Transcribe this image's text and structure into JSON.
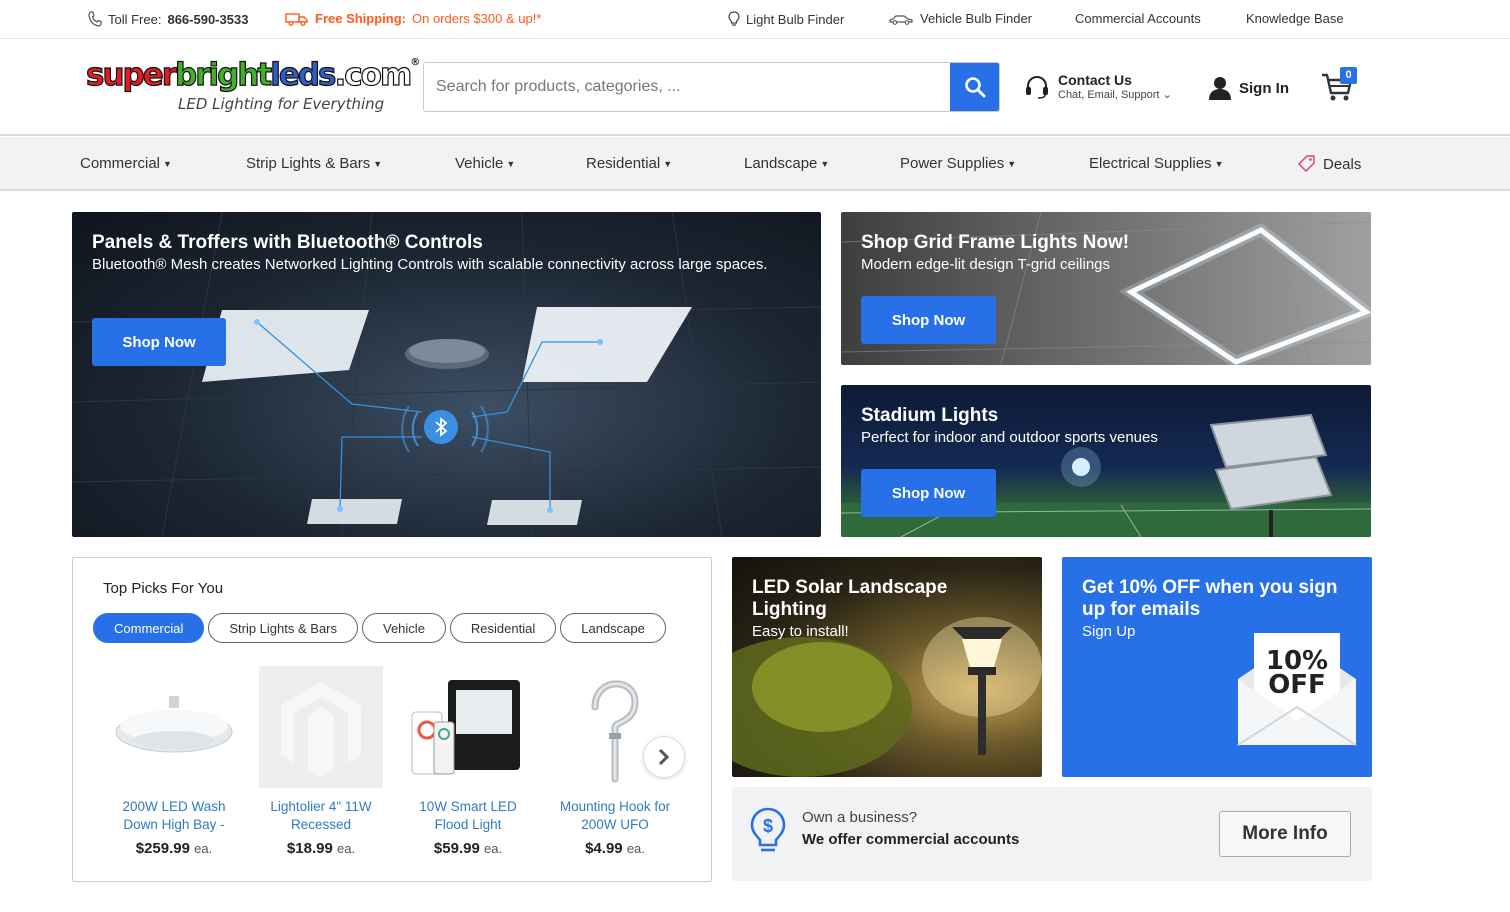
{
  "topbar": {
    "toll_free_label": "Toll Free:",
    "toll_free_number": "866-590-3533",
    "shipping_bold": "Free Shipping:",
    "shipping_text": "On orders $300 & up!*",
    "links": [
      "Light Bulb Finder",
      "Vehicle Bulb Finder",
      "Commercial Accounts",
      "Knowledge Base"
    ]
  },
  "header": {
    "logo_parts": [
      "super",
      "bright",
      "leds",
      ".com"
    ],
    "logo_reg": "®",
    "tagline": "LED Lighting for Everything",
    "search_placeholder": "Search for products, categories, ...",
    "contact_title": "Contact Us",
    "contact_sub": "Chat, Email, Support",
    "signin": "Sign In",
    "cart_count": "0"
  },
  "nav": {
    "items": [
      "Commercial",
      "Strip Lights & Bars",
      "Vehicle",
      "Residential",
      "Landscape",
      "Power Supplies",
      "Electrical Supplies"
    ],
    "deals": "Deals"
  },
  "banners": {
    "panels": {
      "title": "Panels & Troffers with Bluetooth® Controls",
      "text": "Bluetooth® Mesh creates Networked Lighting Controls with scalable connectivity across large spaces.",
      "button": "Shop Now"
    },
    "grid": {
      "title": "Shop Grid Frame Lights Now!",
      "text": "Modern edge-lit design T-grid ceilings",
      "button": "Shop Now"
    },
    "stadium": {
      "title": "Stadium Lights",
      "text": "Perfect for indoor and outdoor sports venues",
      "button": "Shop Now"
    },
    "solar": {
      "title": "LED Solar Landscape Lighting",
      "text": "Easy to install!"
    },
    "email": {
      "title": "Get 10% OFF when you sign up for emails",
      "text": "Sign Up",
      "badge_pct": "10%",
      "badge_off": "OFF"
    }
  },
  "picks": {
    "title": "Top Picks For You",
    "tabs": [
      "Commercial",
      "Strip Lights & Bars",
      "Vehicle",
      "Residential",
      "Landscape"
    ],
    "active_tab": "Commercial",
    "products": [
      {
        "name": "200W LED Wash Down High Bay -",
        "price": "$259.99",
        "unit": "ea."
      },
      {
        "name": "Lightolier 4\" 11W Recessed",
        "price": "$18.99",
        "unit": "ea."
      },
      {
        "name": "10W Smart LED Flood Light",
        "price": "$59.99",
        "unit": "ea."
      },
      {
        "name": "Mounting Hook for 200W UFO",
        "price": "$4.99",
        "unit": "ea."
      }
    ]
  },
  "business": {
    "question": "Own a business?",
    "statement": "We offer commercial accounts",
    "button": "More Info"
  },
  "colors": {
    "accent_blue": "#2870e8",
    "shipping_orange": "#ff5a1f",
    "product_link": "#2f7bc4"
  }
}
